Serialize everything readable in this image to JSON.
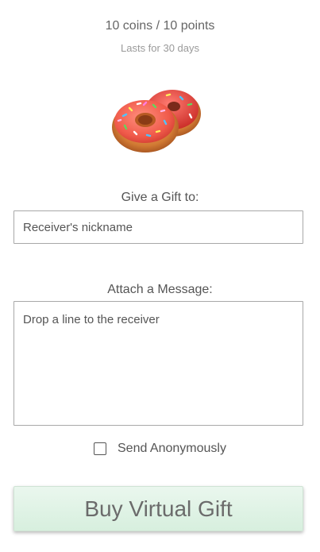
{
  "gift": {
    "price": "10 coins / 10 points",
    "duration": "Lasts for 30 days",
    "icon": "donut-icon"
  },
  "recipient": {
    "label": "Give a Gift to:",
    "placeholder": "Receiver's nickname"
  },
  "message": {
    "label": "Attach a Message:",
    "placeholder": "Drop a line to the receiver"
  },
  "anonymous": {
    "label": "Send Anonymously",
    "checked": false
  },
  "buy_button": {
    "label": "Buy Virtual Gift"
  },
  "colors": {
    "button_bg": "#d7efde",
    "frosting": "#f36b5e",
    "dough": "#d78a3c"
  }
}
